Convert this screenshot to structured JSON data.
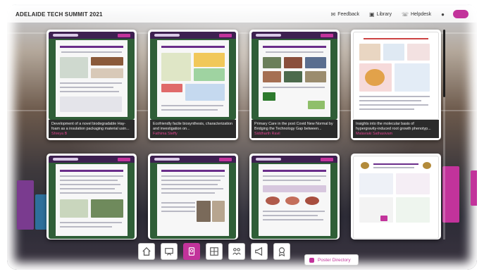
{
  "app": {
    "title": "ADELAIDE TECH SUMMIT 2021"
  },
  "topbar": {
    "links": [
      {
        "icon": "chat-icon",
        "label": "Feedback"
      },
      {
        "icon": "briefcase-icon",
        "label": "Library"
      },
      {
        "icon": "megaphone-icon",
        "label": "Helpdesk"
      }
    ]
  },
  "posters": [
    {
      "title": "Development of a novel biodegradable Hay-foam as a insulation packaging material usin...",
      "author": "Shreya B"
    },
    {
      "title": "Ecofriendly facile biosynthesis, characterization and investigation on...",
      "author": "Fathima Steffy"
    },
    {
      "title": "Primary Care in the post Covid New Normal by Bridging the Technology Gap between...",
      "author": "Siddharth Ravil"
    },
    {
      "title": "Insights into the molecular basis of hypergravity-induced root growth phenotyp...",
      "author": "Malaviaki Sathasivam"
    },
    {
      "title": "",
      "author": ""
    },
    {
      "title": "",
      "author": ""
    },
    {
      "title": "",
      "author": ""
    },
    {
      "title": "",
      "author": ""
    }
  ],
  "toolbar": {
    "items": [
      {
        "name": "home-icon"
      },
      {
        "name": "presentation-icon"
      },
      {
        "name": "poster-icon",
        "active": true
      },
      {
        "name": "booths-icon"
      },
      {
        "name": "networking-icon"
      },
      {
        "name": "announcement-icon"
      },
      {
        "name": "award-icon"
      }
    ],
    "directory_label": "Poster Directory"
  },
  "colors": {
    "accent": "#c2339b",
    "poster_header": "#3d2050",
    "poster_bg": "#2f5e37"
  }
}
